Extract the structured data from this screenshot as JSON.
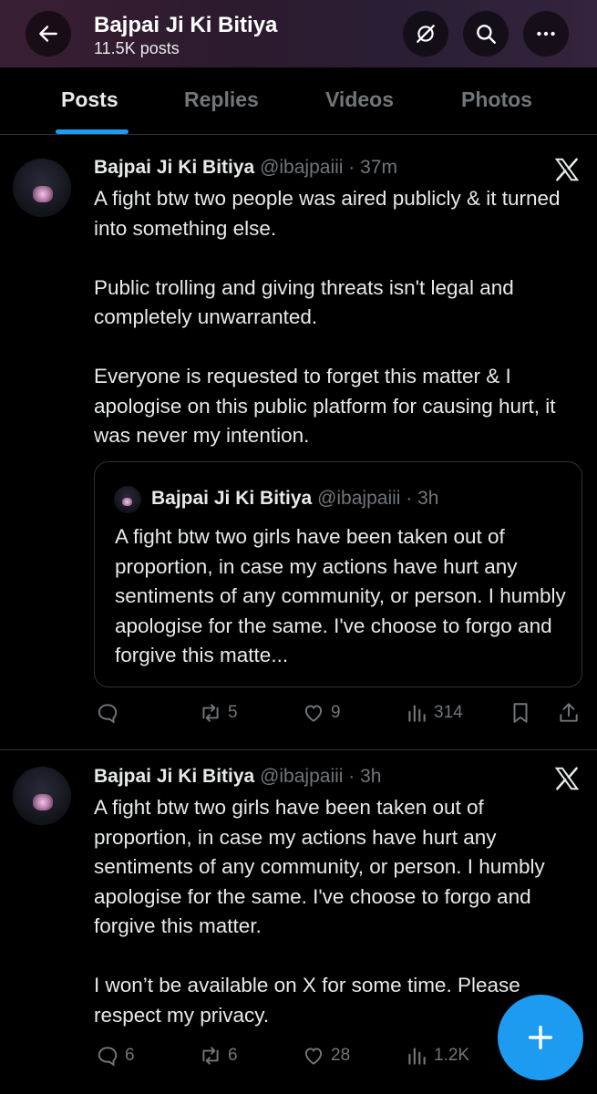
{
  "header": {
    "title": "Bajpai Ji Ki Bitiya",
    "post_count": "11.5K posts",
    "back_icon": "arrow-left-icon",
    "icons": [
      "grok-icon",
      "search-icon",
      "more-icon"
    ]
  },
  "tabs": [
    {
      "label": "Posts",
      "active": true
    },
    {
      "label": "Replies",
      "active": false
    },
    {
      "label": "Videos",
      "active": false
    },
    {
      "label": "Photos",
      "active": false
    }
  ],
  "posts": [
    {
      "name": "Bajpai Ji Ki Bitiya",
      "meta": "@ibajpaiii · 37m",
      "text": "A fight btw two people was aired publicly & it turned into something else.\n\nPublic trolling and giving threats isn't legal and completely unwarranted.\n\nEveryone is requested to forget this matter & I apologise on this public platform for causing hurt, it was never my intention.",
      "quote": {
        "name": "Bajpai Ji Ki Bitiya",
        "meta": "@ibajpaiii · 3h",
        "text": "A fight btw two girls have been taken out of proportion, in case my actions have hurt any sentiments of any community, or person. I humbly apologise for the same. I've choose to forgo and forgive this matte..."
      },
      "actions": {
        "replies": "",
        "reposts": "5",
        "likes": "9",
        "views": "314"
      }
    },
    {
      "name": "Bajpai Ji Ki Bitiya",
      "meta": "@ibajpaiii · 3h",
      "text": "A fight btw two girls have been taken out of proportion, in case my actions have hurt any sentiments of any community, or person. I humbly apologise for the same. I've choose to forgo and forgive this matter.\n\nI won’t be available on X for some time. Please respect my privacy.",
      "actions": {
        "replies": "6",
        "reposts": "6",
        "likes": "28",
        "views": "1.2K"
      }
    }
  ],
  "colors": {
    "accent": "#1d9bf0",
    "muted": "#71767b",
    "text": "#e7e9ea",
    "border": "#2f3336"
  }
}
